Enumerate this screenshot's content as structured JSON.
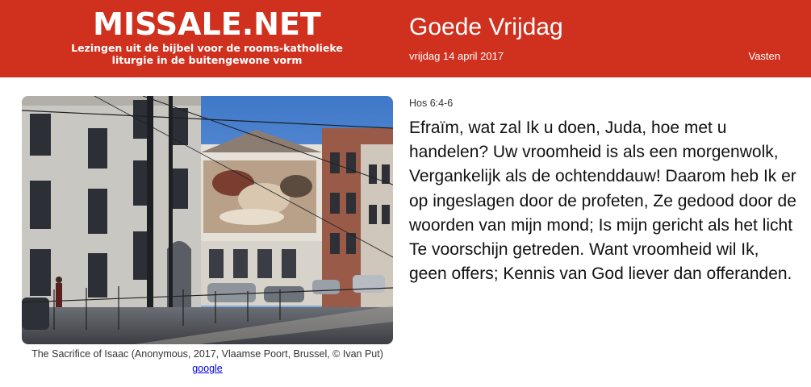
{
  "header": {
    "site_title": "MISSALE.NET",
    "site_subtitle": "Lezingen uit de bijbel voor de rooms-katholieke liturgie in de buitengewone vorm",
    "day_title": "Goede Vrijdag",
    "date": "vrijdag 14 april 2017",
    "season": "Vasten"
  },
  "figure": {
    "image_alt": "The Sacrifice of Isaac",
    "caption": "The Sacrifice of Isaac (Anonymous, 2017, Vlaamse Poort, Brussel, © Ivan Put)",
    "link_label": "google"
  },
  "reading": {
    "reference": "Hos 6:4-6",
    "text": "Efraïm, wat zal Ik u doen, Juda, hoe met u handelen? Uw vroomheid is als een morgenwolk, Vergankelijk als de ochtenddauw! Daarom heb Ik er op ingeslagen door de profeten, Ze gedood door de woorden van mijn mond; Is mijn gericht als het licht Te voorschijn getreden. Want vroomheid wil Ik, geen offers; Kennis van God liever dan offeranden."
  },
  "colors": {
    "header_bg": "#d0311f",
    "link": "#0000ee"
  }
}
